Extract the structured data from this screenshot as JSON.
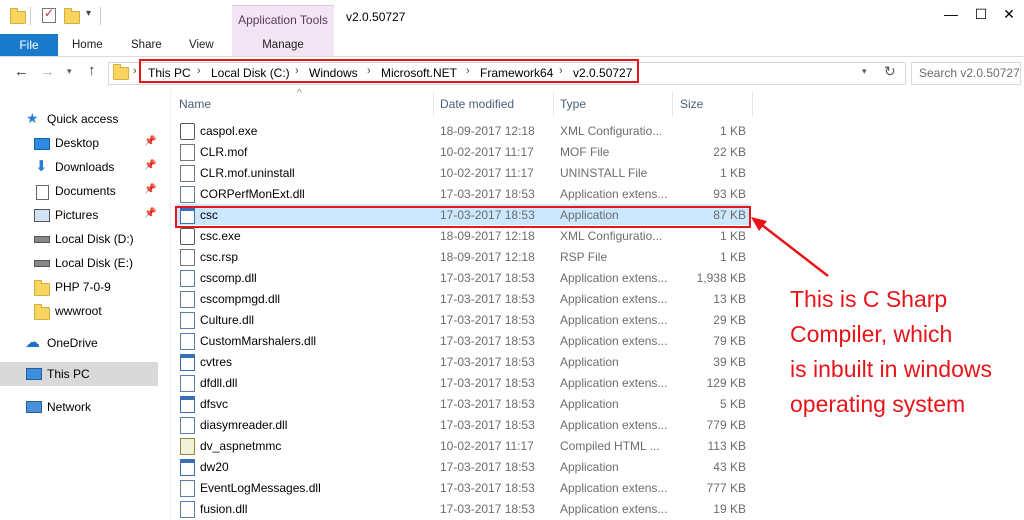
{
  "window": {
    "title": "v2.0.50727",
    "context_tab_group": "Application Tools",
    "controls": {
      "minimize": "—",
      "maximize": "☐",
      "close": "✕"
    }
  },
  "ribbon": {
    "tabs": [
      "File",
      "Home",
      "Share",
      "View",
      "Manage"
    ]
  },
  "navigation": {
    "breadcrumbs": [
      "This PC",
      "Local Disk (C:)",
      "Windows",
      "Microsoft.NET",
      "Framework64",
      "v2.0.50727"
    ],
    "search_placeholder": "Search v2.0.50727"
  },
  "sidebar": {
    "items": [
      {
        "label": "Quick access",
        "icon": "star-icon"
      },
      {
        "label": "Desktop",
        "icon": "desktop-icon",
        "pinned": true
      },
      {
        "label": "Downloads",
        "icon": "download-icon",
        "pinned": true
      },
      {
        "label": "Documents",
        "icon": "documents-icon",
        "pinned": true
      },
      {
        "label": "Pictures",
        "icon": "pictures-icon",
        "pinned": true
      },
      {
        "label": "Local Disk (D:)",
        "icon": "drive-icon"
      },
      {
        "label": "Local Disk (E:)",
        "icon": "drive-icon"
      },
      {
        "label": "PHP 7-0-9",
        "icon": "folder-icon"
      },
      {
        "label": "wwwroot",
        "icon": "folder-icon"
      },
      {
        "label": "OneDrive",
        "icon": "cloud-icon"
      },
      {
        "label": "This PC",
        "icon": "computer-icon"
      },
      {
        "label": "Network",
        "icon": "network-icon"
      }
    ]
  },
  "columns": {
    "name": "Name",
    "date": "Date modified",
    "type": "Type",
    "size": "Size"
  },
  "files": [
    {
      "name": "caspol.exe",
      "date": "18-09-2017 12:18",
      "type": "XML Configuratio...",
      "size": "1 KB",
      "icon": "config-file-icon"
    },
    {
      "name": "CLR.mof",
      "date": "10-02-2017 11:17",
      "type": "MOF File",
      "size": "22 KB",
      "icon": "file-icon"
    },
    {
      "name": "CLR.mof.uninstall",
      "date": "10-02-2017 11:17",
      "type": "UNINSTALL File",
      "size": "1 KB",
      "icon": "file-icon"
    },
    {
      "name": "CORPerfMonExt.dll",
      "date": "17-03-2017 18:53",
      "type": "Application extens...",
      "size": "93 KB",
      "icon": "dll-icon"
    },
    {
      "name": "csc",
      "date": "17-03-2017 18:53",
      "type": "Application",
      "size": "87 KB",
      "icon": "application-icon",
      "selected": true
    },
    {
      "name": "csc.exe",
      "date": "18-09-2017 12:18",
      "type": "XML Configuratio...",
      "size": "1 KB",
      "icon": "config-file-icon"
    },
    {
      "name": "csc.rsp",
      "date": "18-09-2017 12:18",
      "type": "RSP File",
      "size": "1 KB",
      "icon": "file-icon"
    },
    {
      "name": "cscomp.dll",
      "date": "17-03-2017 18:53",
      "type": "Application extens...",
      "size": "1,938 KB",
      "icon": "dll-icon"
    },
    {
      "name": "cscompmgd.dll",
      "date": "17-03-2017 18:53",
      "type": "Application extens...",
      "size": "13 KB",
      "icon": "dll-icon"
    },
    {
      "name": "Culture.dll",
      "date": "17-03-2017 18:53",
      "type": "Application extens...",
      "size": "29 KB",
      "icon": "dll-icon"
    },
    {
      "name": "CustomMarshalers.dll",
      "date": "17-03-2017 18:53",
      "type": "Application extens...",
      "size": "79 KB",
      "icon": "dll-icon"
    },
    {
      "name": "cvtres",
      "date": "17-03-2017 18:53",
      "type": "Application",
      "size": "39 KB",
      "icon": "application-icon"
    },
    {
      "name": "dfdll.dll",
      "date": "17-03-2017 18:53",
      "type": "Application extens...",
      "size": "129 KB",
      "icon": "dll-icon"
    },
    {
      "name": "dfsvc",
      "date": "17-03-2017 18:53",
      "type": "Application",
      "size": "5 KB",
      "icon": "application-icon"
    },
    {
      "name": "diasymreader.dll",
      "date": "17-03-2017 18:53",
      "type": "Application extens...",
      "size": "779 KB",
      "icon": "dll-icon"
    },
    {
      "name": "dv_aspnetmmc",
      "date": "10-02-2017 11:17",
      "type": "Compiled HTML ...",
      "size": "113 KB",
      "icon": "help-file-icon"
    },
    {
      "name": "dw20",
      "date": "17-03-2017 18:53",
      "type": "Application",
      "size": "43 KB",
      "icon": "application-icon"
    },
    {
      "name": "EventLogMessages.dll",
      "date": "17-03-2017 18:53",
      "type": "Application extens...",
      "size": "777 KB",
      "icon": "dll-icon"
    },
    {
      "name": "fusion.dll",
      "date": "17-03-2017 18:53",
      "type": "Application extens...",
      "size": "19 KB",
      "icon": "dll-icon"
    }
  ],
  "annotation": {
    "text": "This is C Sharp\nCompiler, which\nis inbuilt in windows\noperating system",
    "color": "#e8141a"
  },
  "colors": {
    "accent": "#1979ca",
    "selection": "#cce8ff",
    "highlight": "#e8141a",
    "context_tab": "#f4e5f4"
  }
}
